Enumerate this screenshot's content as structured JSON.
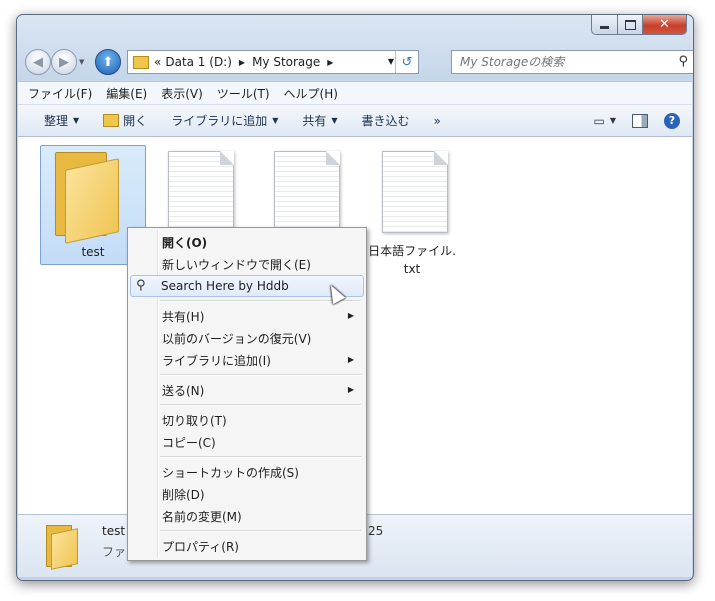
{
  "window": {
    "caption_buttons": [
      "minimize-icon",
      "maximize-icon",
      "close-icon"
    ],
    "close_glyph": "✕"
  },
  "nav": {
    "back_glyph": "◀",
    "forward_glyph": "▶",
    "up_glyph": "⬆"
  },
  "address": {
    "overflow": "«",
    "crumbs": [
      "Data 1 (D:)",
      "My Storage"
    ],
    "sep": "▶"
  },
  "search": {
    "placeholder": "My Storageの検索"
  },
  "menubar": {
    "items": [
      "ファイル(F)",
      "編集(E)",
      "表示(V)",
      "ツール(T)",
      "ヘルプ(H)"
    ]
  },
  "toolbar": {
    "organize": "整理",
    "open": "開く",
    "add_to_library": "ライブラリに追加",
    "share": "共有",
    "burn": "書き込む",
    "more": "»"
  },
  "items": [
    {
      "label": "test",
      "type": "folder",
      "selected": true
    },
    {
      "label": "",
      "type": "document"
    },
    {
      "label": "",
      "type": "document"
    },
    {
      "label": "日本語ファイル.",
      "label2": "txt",
      "type": "document"
    }
  ],
  "details": {
    "name": "test",
    "type": "ファ",
    "extra": "25"
  },
  "context_menu": {
    "items": [
      {
        "label": "開く(O)",
        "bold": true
      },
      {
        "label": "新しいウィンドウで開く(E)"
      },
      {
        "label": "Search Here by Hddb",
        "hover": true,
        "icon": "search-icon"
      },
      {
        "label": "共有(H)",
        "submenu": true
      },
      {
        "label": "以前のバージョンの復元(V)"
      },
      {
        "label": "ライブラリに追加(I)",
        "submenu": true
      },
      {
        "label": "送る(N)",
        "submenu": true
      },
      {
        "label": "切り取り(T)"
      },
      {
        "label": "コピー(C)"
      },
      {
        "label": "ショートカットの作成(S)"
      },
      {
        "label": "削除(D)"
      },
      {
        "label": "名前の変更(M)"
      },
      {
        "label": "プロパティ(R)"
      }
    ]
  }
}
